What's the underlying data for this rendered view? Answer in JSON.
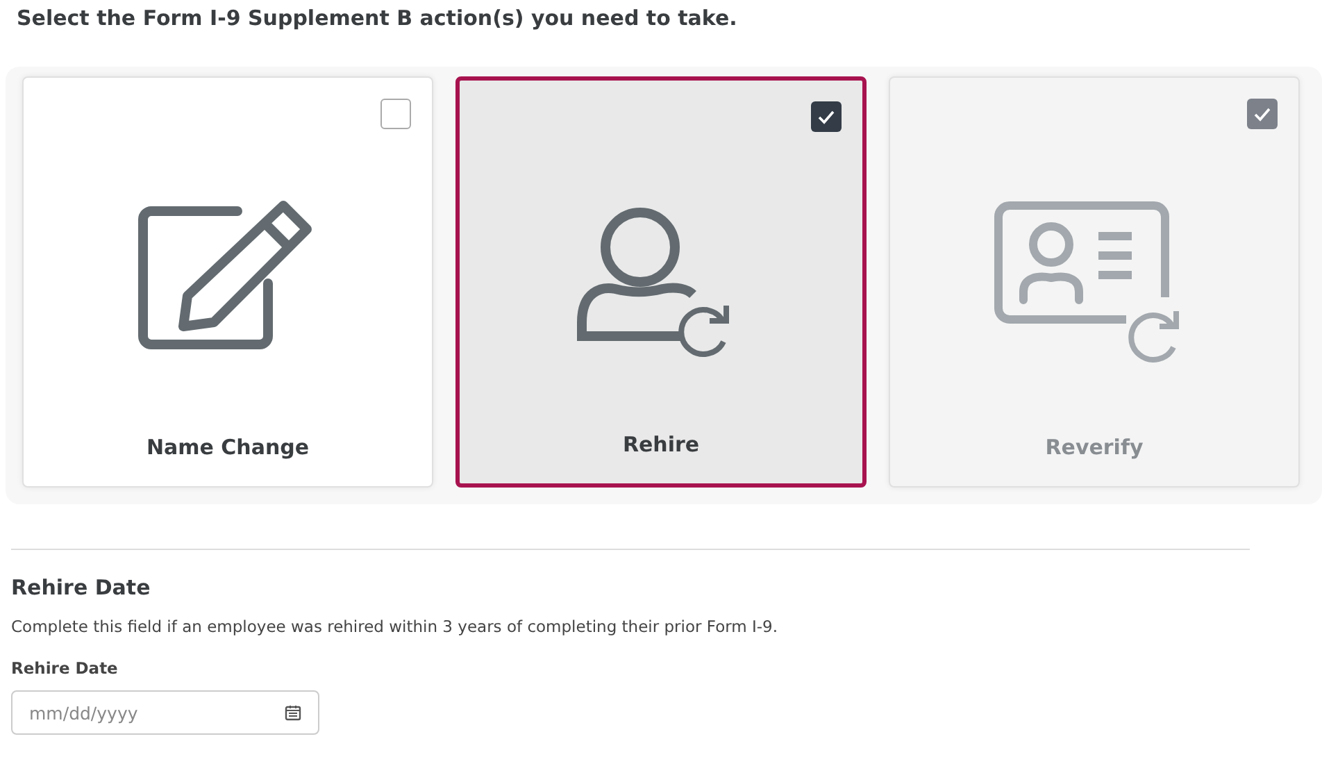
{
  "heading": "Select the Form I-9 Supplement B action(s) you need to take.",
  "actions": [
    {
      "kind": "edit",
      "label": "Name Change",
      "checked": false,
      "selected": false,
      "disabled": false
    },
    {
      "kind": "rehire",
      "label": "Rehire",
      "checked": true,
      "selected": true,
      "disabled": false
    },
    {
      "kind": "reverify",
      "label": "Reverify",
      "checked": true,
      "selected": false,
      "disabled": true
    }
  ],
  "section": {
    "title": "Rehire Date",
    "description": "Complete this field if an employee was rehired within 3 years of completing their prior Form I-9.",
    "field_label": "Rehire Date",
    "placeholder": "mm/dd/yyyy"
  }
}
